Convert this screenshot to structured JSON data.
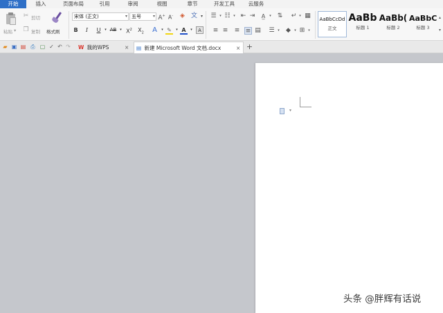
{
  "menu": {
    "tabs": [
      "开始",
      "插入",
      "页面布局",
      "引用",
      "审阅",
      "视图",
      "章节",
      "开发工具",
      "云服务"
    ],
    "active_tab": "开始",
    "accent_color": "#2e6fc7"
  },
  "ribbon": {
    "paste_label": "粘贴",
    "cut_label": "剪切",
    "copy_label": "复制",
    "format_painter_label": "格式刷",
    "font_name": "宋体 (正文)",
    "font_size": "五号",
    "font_color": "#1f4fc8",
    "highlight_color": "#f2d50f",
    "styles": [
      {
        "sample": "AaBbCcDd",
        "name": "正文"
      },
      {
        "sample": "AaBb",
        "name": "标题 1"
      },
      {
        "sample": "AaBb(",
        "name": "标题 2"
      },
      {
        "sample": "AaBbC",
        "name": "标题 3"
      }
    ]
  },
  "tabs": {
    "wps_tab": "我的WPS",
    "doc_tab": "新建 Microsoft Word 文档.docx",
    "close_glyph": "×",
    "add_glyph": "+"
  },
  "watermark": "头条 @胖辉有话说"
}
